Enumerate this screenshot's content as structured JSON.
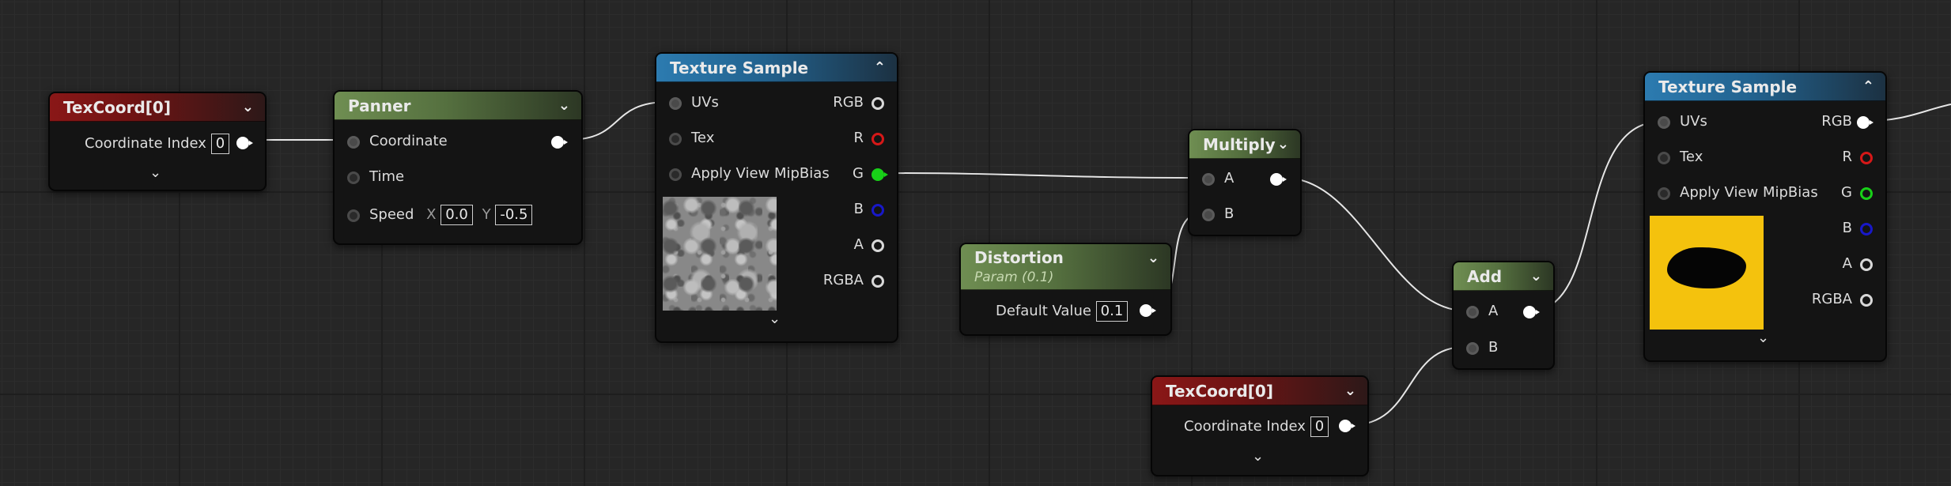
{
  "nodes": {
    "texcoord1": {
      "title": "TexCoord[0]",
      "coord_label": "Coordinate Index",
      "coord_value": "0"
    },
    "panner": {
      "title": "Panner",
      "coordinate": "Coordinate",
      "time": "Time",
      "speed": "Speed",
      "x_label": "X",
      "x_value": "0.0",
      "y_label": "Y",
      "y_value": "-0.5"
    },
    "texsample1": {
      "title": "Texture Sample",
      "uvs": "UVs",
      "tex": "Tex",
      "mipbias": "Apply View MipBias",
      "rgb": "RGB",
      "r": "R",
      "g": "G",
      "b": "B",
      "a": "A",
      "rgba": "RGBA"
    },
    "multiply": {
      "title": "Multiply",
      "a": "A",
      "b": "B"
    },
    "distortion": {
      "title": "Distortion",
      "subtitle": "Param (0.1)",
      "default_label": "Default Value",
      "default_value": "0.1"
    },
    "add": {
      "title": "Add",
      "a": "A",
      "b": "B"
    },
    "texcoord2": {
      "title": "TexCoord[0]",
      "coord_label": "Coordinate Index",
      "coord_value": "0"
    },
    "texsample2": {
      "title": "Texture Sample",
      "uvs": "UVs",
      "tex": "Tex",
      "mipbias": "Apply View MipBias",
      "rgb": "RGB",
      "r": "R",
      "g": "G",
      "b": "B",
      "a": "A",
      "rgba": "RGBA"
    }
  },
  "icons": {
    "collapse": "chevron-up-icon",
    "expand": "chevron-down-icon"
  },
  "colors": {
    "wire": "#e6e6e6",
    "pin_r": "#d61818",
    "pin_g": "#18d018",
    "pin_b": "#1818c8",
    "preview_yellow": "#f4c20d"
  }
}
